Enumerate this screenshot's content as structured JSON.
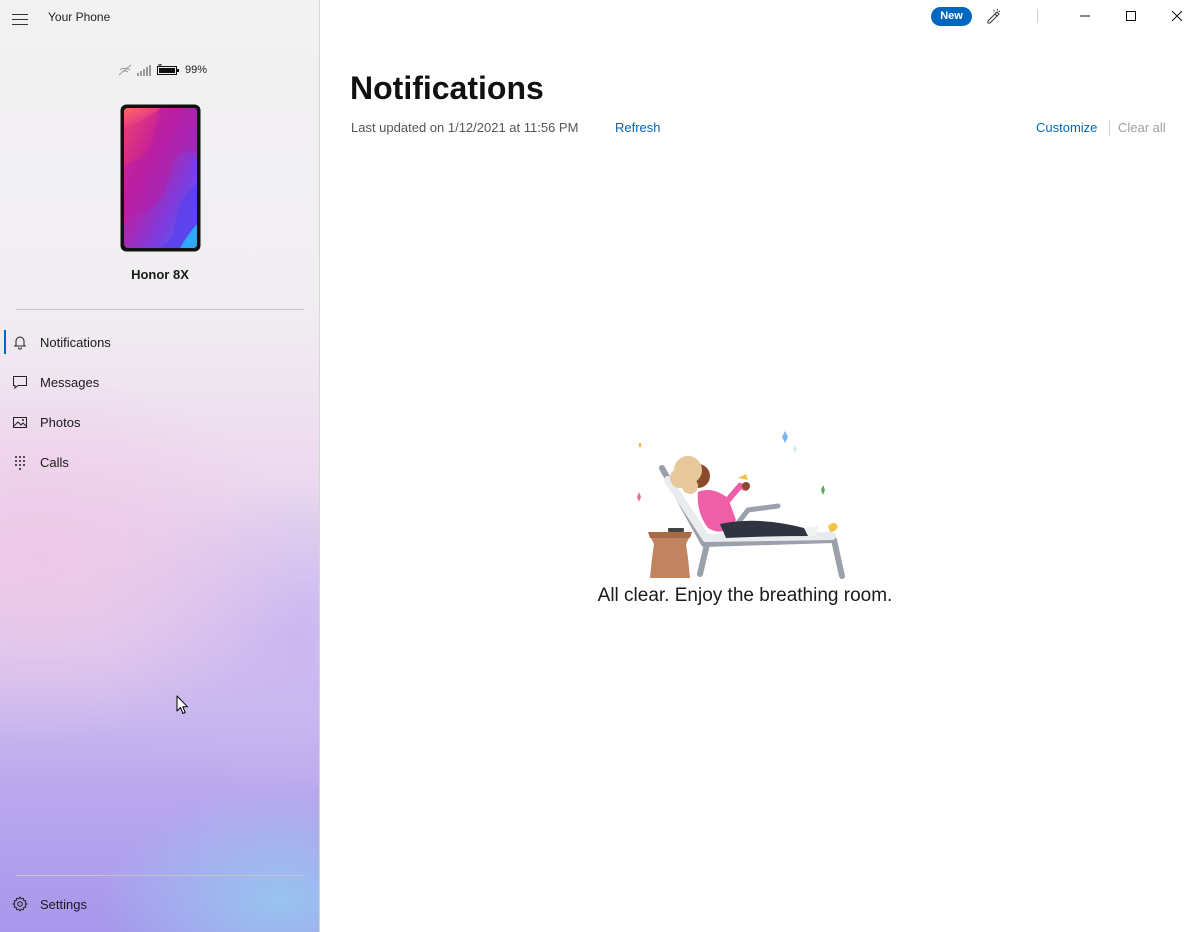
{
  "app": {
    "title": "Your Phone",
    "new_badge": "New"
  },
  "device": {
    "battery": "99%",
    "name": "Honor 8X"
  },
  "sidebar": {
    "items": [
      {
        "label": "Notifications",
        "icon": "bell-icon",
        "active": true
      },
      {
        "label": "Messages",
        "icon": "chat-bubble-icon",
        "active": false
      },
      {
        "label": "Photos",
        "icon": "photo-icon",
        "active": false
      },
      {
        "label": "Calls",
        "icon": "dialpad-icon",
        "active": false
      }
    ],
    "settings_label": "Settings"
  },
  "main": {
    "title": "Notifications",
    "last_updated": "Last updated on 1/12/2021 at 11:56 PM",
    "refresh": "Refresh",
    "customize": "Customize",
    "clear_all": "Clear all",
    "empty_message": "All clear. Enjoy the breathing room."
  },
  "colors": {
    "accent": "#0067c0",
    "disabled_text": "#a0a0a0"
  }
}
